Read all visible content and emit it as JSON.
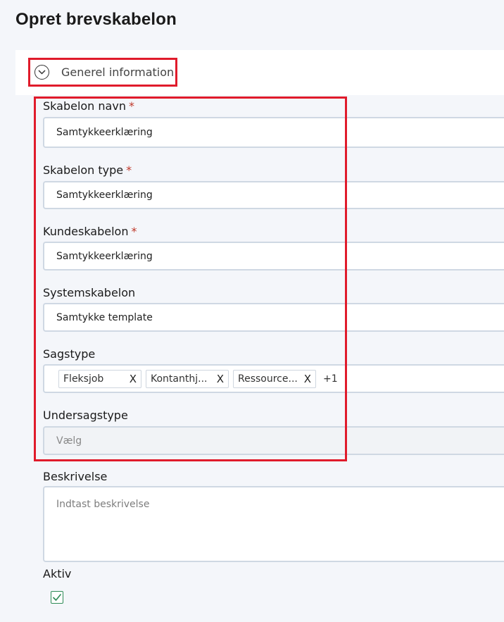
{
  "page": {
    "title": "Opret brevskabelon"
  },
  "section": {
    "title": "Generel information"
  },
  "fields": {
    "skabelon_navn": {
      "label": "Skabelon navn",
      "required": "*",
      "value": "Samtykkeerklæring"
    },
    "skabelon_type": {
      "label": "Skabelon type",
      "required": "*",
      "value": "Samtykkeerklæring"
    },
    "kundeskabelon": {
      "label": "Kundeskabelon",
      "required": "*",
      "value": "Samtykkeerklæring"
    },
    "systemskabelon": {
      "label": "Systemskabelon",
      "value": "Samtykke template"
    },
    "sagstype": {
      "label": "Sagstype",
      "tags": [
        {
          "label": "Fleksjob",
          "remove": "X"
        },
        {
          "label": "Kontanthj...",
          "remove": "X"
        },
        {
          "label": "Ressource...",
          "remove": "X"
        }
      ],
      "more": "+1"
    },
    "undersagstype": {
      "label": "Undersagstype",
      "placeholder": "Vælg"
    },
    "beskrivelse": {
      "label": "Beskrivelse",
      "placeholder": "Indtast beskrivelse"
    },
    "aktiv": {
      "label": "Aktiv",
      "checked": true
    }
  },
  "colors": {
    "highlight": "#e01b2b",
    "required": "#c0392b",
    "checkbox": "#2e8b57"
  },
  "icons": {
    "section_toggle": "chevron-down-circle-icon",
    "checkbox": "checkmark-icon"
  }
}
